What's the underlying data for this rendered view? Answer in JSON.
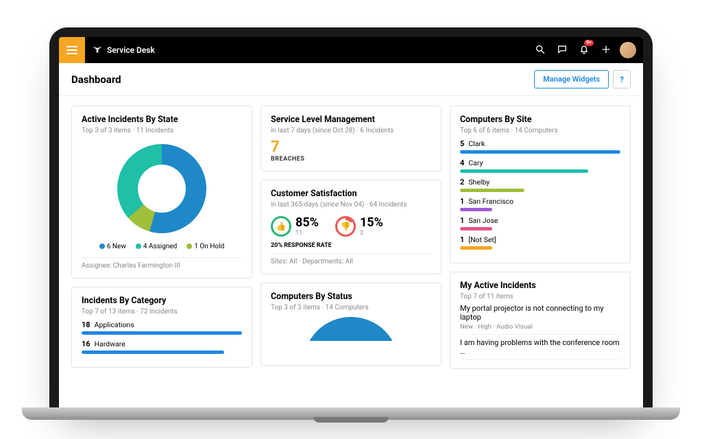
{
  "header": {
    "app_name": "Service Desk",
    "badge": "9+"
  },
  "page": {
    "title": "Dashboard",
    "manage_widgets": "Manage Widgets",
    "help": "?"
  },
  "widgets": {
    "active_incidents": {
      "title": "Active Incidents By State",
      "subtitle": "Top 3 of 3 items  ·  11 Incidents",
      "legend": [
        {
          "color": "#1e88c8",
          "label": "6 New"
        },
        {
          "color": "#1fbfa8",
          "label": "4 Assigned"
        },
        {
          "color": "#9fbf3a",
          "label": "1 On Hold"
        }
      ],
      "footer": "Assignee: Charles Farmington III"
    },
    "slm": {
      "title": "Service Level Management",
      "subtitle": "in last 7 days (since Oct 28)  ·  6 Incidents",
      "value": "7",
      "value_label": "BREACHES"
    },
    "csat": {
      "title": "Customer Satisfaction",
      "subtitle": "in last 365 days (since Nov 04)  ·  64 Incidents",
      "up_pct": "85%",
      "up_cnt": "11",
      "down_pct": "15%",
      "down_cnt": "2",
      "response_rate": "20% RESPONSE RATE",
      "footer": "Sites: All   ·   Departments: All"
    },
    "by_status": {
      "title": "Computers By Status",
      "subtitle": "Top 3 of 3 items  ·  14 Computers"
    },
    "by_site": {
      "title": "Computers By Site",
      "subtitle": "Top 6 of 6 items  ·  14 Computers",
      "rows": [
        {
          "count": "5",
          "label": "Clark",
          "pct": 100,
          "color": "#1e88e5"
        },
        {
          "count": "4",
          "label": "Cary",
          "pct": 80,
          "color": "#1fbfa8"
        },
        {
          "count": "2",
          "label": "Shelby",
          "pct": 40,
          "color": "#9fbf3a"
        },
        {
          "count": "1",
          "label": "San Francisco",
          "pct": 20,
          "color": "#a05bd6"
        },
        {
          "count": "1",
          "label": "San Jose",
          "pct": 20,
          "color": "#e0558b"
        },
        {
          "count": "1",
          "label": "[Not Set]",
          "pct": 20,
          "color": "#f5a623"
        }
      ]
    },
    "by_category": {
      "title": "Incidents By Category",
      "subtitle": "Top 7 of 13 items  ·  72 Incidents",
      "rows": [
        {
          "count": "18",
          "label": "Applications",
          "pct": 100,
          "color": "#1e88e5"
        },
        {
          "count": "16",
          "label": "Hardware",
          "pct": 89,
          "color": "#1e88e5"
        }
      ]
    },
    "my_incidents": {
      "title": "My Active Incidents",
      "subtitle": "Top 7 of 11 items",
      "items": [
        {
          "title": "My portal projector is not connecting to my laptop",
          "meta": "New   ·   High   ·   Audio Visual"
        },
        {
          "title": "I am having problems with the conference room …",
          "meta": ""
        }
      ]
    }
  },
  "chart_data": [
    {
      "type": "pie",
      "title": "Active Incidents By State",
      "series": [
        {
          "name": "New",
          "value": 6
        },
        {
          "name": "Assigned",
          "value": 4
        },
        {
          "name": "On Hold",
          "value": 1
        }
      ]
    },
    {
      "type": "bar",
      "title": "Computers By Site",
      "categories": [
        "Clark",
        "Cary",
        "Shelby",
        "San Francisco",
        "San Jose",
        "[Not Set]"
      ],
      "values": [
        5,
        4,
        2,
        1,
        1,
        1
      ]
    },
    {
      "type": "bar",
      "title": "Incidents By Category",
      "categories": [
        "Applications",
        "Hardware"
      ],
      "values": [
        18,
        16
      ]
    }
  ]
}
